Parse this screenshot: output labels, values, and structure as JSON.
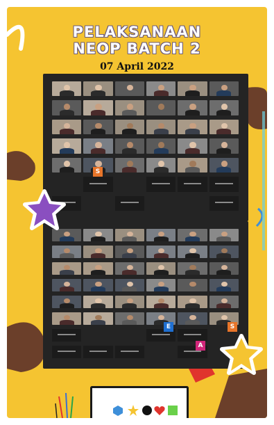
{
  "poster": {
    "title_line1": "PELAKSANAAN",
    "title_line2": "NEOP BATCH 2",
    "date": "07 April 2022"
  },
  "colors": {
    "background": "#f5c431",
    "panel": "#242424",
    "brown": "#6b3f2a",
    "purple_star": "#8a4fc0",
    "yellow_star": "#f5c431",
    "red": "#e0342d"
  },
  "meeting1": {
    "tile_letter": "S",
    "tile_letter_color": "#e8752a"
  },
  "meeting2": {
    "tile_letters": [
      {
        "letter": "E",
        "color": "#1f6fd1"
      },
      {
        "letter": "S",
        "color": "#e8752a"
      },
      {
        "letter": "A",
        "color": "#d1267a"
      }
    ]
  },
  "icons": [
    "hexagon-icon",
    "star-icon",
    "circle-icon",
    "heart-icon",
    "square-icon"
  ]
}
